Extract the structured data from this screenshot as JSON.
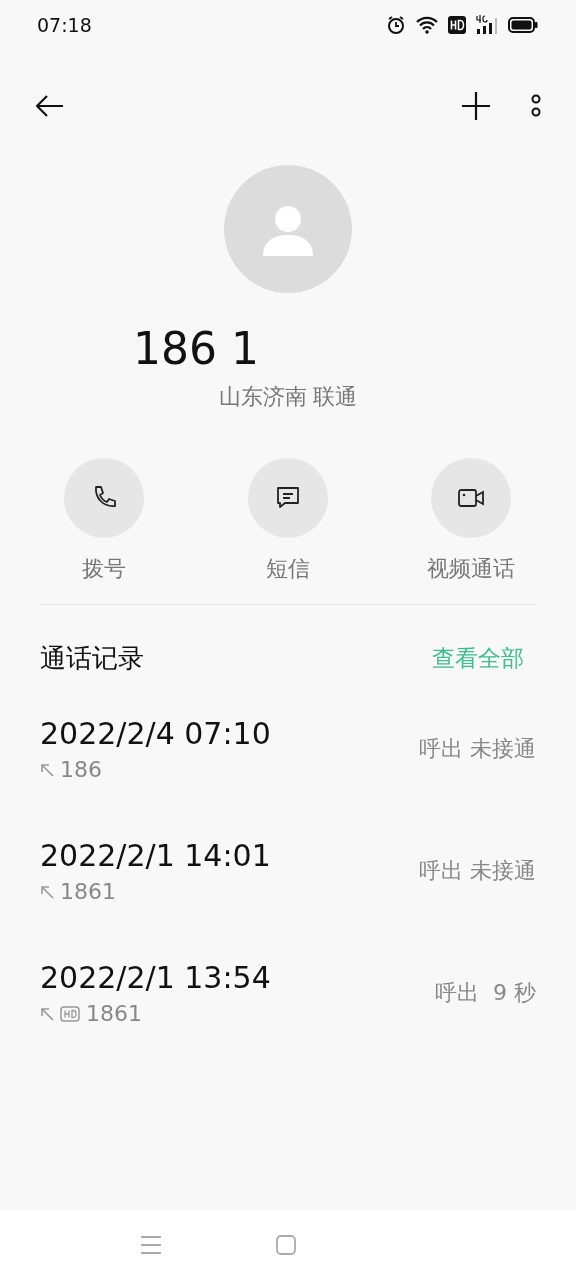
{
  "status_bar": {
    "time": "07:18"
  },
  "contact": {
    "number": "186 1",
    "location": "山东济南 联通"
  },
  "actions": [
    {
      "kind": "call",
      "label": "拨号"
    },
    {
      "kind": "message",
      "label": "短信"
    },
    {
      "kind": "video",
      "label": "视频通话"
    }
  ],
  "call_log": {
    "title": "通话记录",
    "view_all": "查看全部",
    "entries": [
      {
        "datetime": "2022/2/4 07:10",
        "number": "186",
        "hd": false,
        "result": "呼出 未接通"
      },
      {
        "datetime": "2022/2/1 14:01",
        "number": "1861",
        "hd": false,
        "result": "呼出 未接通"
      },
      {
        "datetime": "2022/2/1 13:54",
        "number": "1861",
        "hd": true,
        "result": "呼出  9 秒"
      }
    ]
  }
}
